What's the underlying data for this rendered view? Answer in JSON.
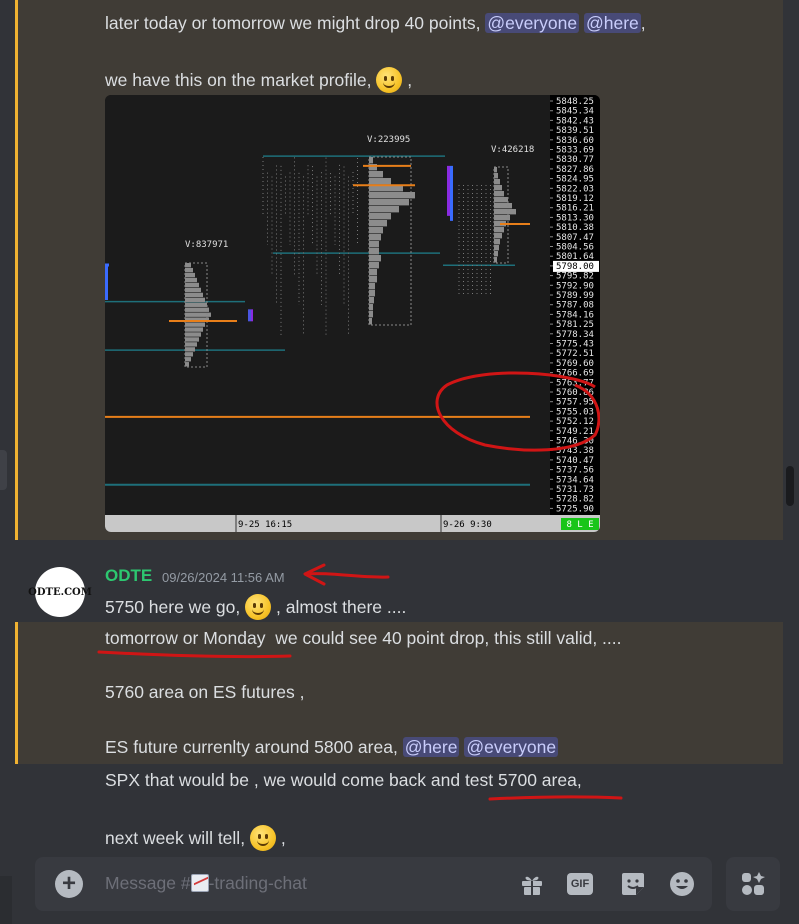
{
  "messages": {
    "m1_prefix": "later today or tomorrow we might drop 40 points, ",
    "m1_mention1": "@everyone",
    "m1_mention2": "@here",
    "m1_suffix": ",",
    "m2_text": "we have this on the market profile,",
    "m2_suffix": ",",
    "author": "ODTE",
    "timestamp": "09/26/2024 11:56 AM",
    "avatar_text": "ODTE.COM",
    "m3_text": "5750 here we go,",
    "m3_suffix": ", almost there ....",
    "m4_underlined": "tomorrow or Monday",
    "m4_rest": "  we could see 40 point drop, this still valid, ....",
    "m5_text": "5760 area on ES futures ,",
    "m6_text": "ES future currenlty around 5800 area, ",
    "m6_mention1": "@here",
    "m6_mention2": "@everyone",
    "m7_text": "SPX that would be , we would come back and ",
    "m7_underlined": "test 5700 area,",
    "m8_text": "next week will tell,",
    "m8_suffix": ","
  },
  "composer": {
    "placeholder_prefix": "Message #",
    "placeholder_suffix": "-trading-chat",
    "add_icon": "plus-icon",
    "gift_icon": "gift-icon",
    "gif_label": "GIF",
    "sticker_icon": "sticker-icon",
    "emoji_icon": "emoji-icon",
    "apps_icon": "apps-icon"
  },
  "chart_image": {
    "price_labels": [
      "5848.25",
      "5845.34",
      "5842.43",
      "5839.51",
      "5836.60",
      "5833.69",
      "5830.77",
      "5827.86",
      "5824.95",
      "5822.03",
      "5819.12",
      "5816.21",
      "5813.30",
      "5810.38",
      "5807.47",
      "5804.56",
      "5801.64",
      "5798.00",
      "5795.82",
      "5792.90",
      "5789.99",
      "5787.08",
      "5784.16",
      "5781.25",
      "5778.34",
      "5775.43",
      "5772.51",
      "5769.60",
      "5766.69",
      "5763.77",
      "5760.86",
      "5757.95",
      "5755.03",
      "5752.12",
      "5749.21",
      "5746.30",
      "5743.38",
      "5740.47",
      "5737.56",
      "5734.64",
      "5731.73",
      "5728.82",
      "5725.90"
    ],
    "current_price": "5798.00",
    "volume_labels": [
      "V:837971",
      "V:223995",
      "V:426218"
    ],
    "time_labels": [
      "9-25  16:15",
      "9-26  9:30"
    ],
    "status_label": "8 L E"
  },
  "colors": {
    "background": "#313338",
    "highlight": "#403c36",
    "highlight_bar": "#f0b232",
    "author": "#2dc770",
    "annotation_red": "#d01515",
    "profile_orange": "#e87f1a",
    "profile_teal": "#1e6f7a"
  }
}
